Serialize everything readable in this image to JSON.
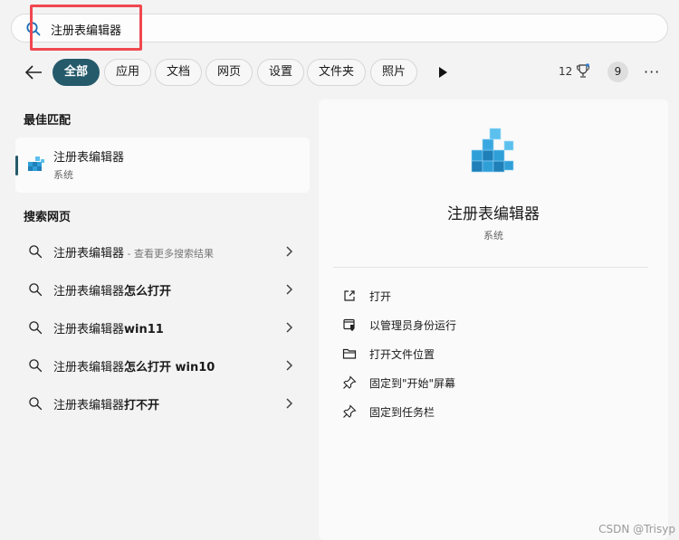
{
  "search": {
    "query": "注册表编辑器"
  },
  "filters": {
    "back_label": "",
    "chips": [
      "全部",
      "应用",
      "文档",
      "网页",
      "设置",
      "文件夹",
      "照片"
    ],
    "active_index": 0,
    "rewards_count": "12",
    "avatar_initial": "9",
    "more_label": "···"
  },
  "best_match": {
    "heading": "最佳匹配",
    "name": "注册表编辑器",
    "subtitle": "系统"
  },
  "web_search": {
    "heading": "搜索网页",
    "items": [
      {
        "prefix": "注册表编辑器",
        "suffix": "",
        "hint": " - 查看更多搜索结果"
      },
      {
        "prefix": "注册表编辑器",
        "suffix": "怎么打开",
        "hint": ""
      },
      {
        "prefix": "注册表编辑器",
        "suffix": "win11",
        "hint": ""
      },
      {
        "prefix": "注册表编辑器",
        "suffix": "怎么打开 win10",
        "hint": ""
      },
      {
        "prefix": "注册表编辑器",
        "suffix": "打不开",
        "hint": ""
      }
    ]
  },
  "detail": {
    "name": "注册表编辑器",
    "subtitle": "系统",
    "actions": [
      {
        "label": "打开",
        "icon": "open-external-icon"
      },
      {
        "label": "以管理员身份运行",
        "icon": "run-as-admin-icon"
      },
      {
        "label": "打开文件位置",
        "icon": "folder-icon"
      },
      {
        "label": "固定到\"开始\"屏幕",
        "icon": "pin-icon"
      },
      {
        "label": "固定到任务栏",
        "icon": "pin-icon"
      }
    ]
  },
  "watermark": "CSDN @Trisyp",
  "colors": {
    "accent": "#255a6a",
    "highlight_box": "#f0474f",
    "regedit_blue": "#2f9fd8"
  }
}
